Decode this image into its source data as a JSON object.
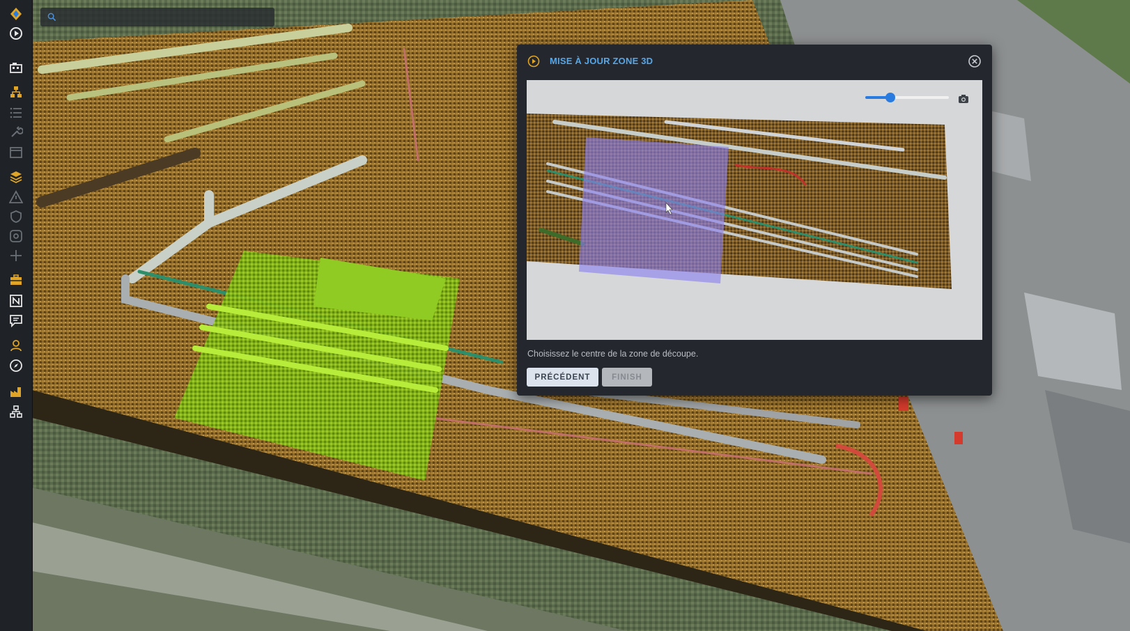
{
  "search": {
    "value": "",
    "placeholder": ""
  },
  "sidebar": {
    "items": [
      {
        "icon": "app-logo-icon"
      },
      {
        "icon": "play-circle-icon"
      },
      {
        "icon": "building-icon"
      },
      {
        "icon": "hierarchy-icon"
      },
      {
        "icon": "list-icon"
      },
      {
        "icon": "wrench-icon"
      },
      {
        "icon": "calendar-icon"
      },
      {
        "icon": "layers-icon"
      },
      {
        "icon": "warning-icon"
      },
      {
        "icon": "shield-icon"
      },
      {
        "icon": "at-sign-icon"
      },
      {
        "icon": "crosshair-icon"
      },
      {
        "icon": "toolbox-icon"
      },
      {
        "icon": "blueprint-icon"
      },
      {
        "icon": "comment-icon"
      },
      {
        "icon": "user-icon"
      },
      {
        "icon": "compass-icon"
      },
      {
        "icon": "factory-icon"
      },
      {
        "icon": "network-icon"
      }
    ]
  },
  "dialog": {
    "title": "MISE À JOUR ZONE 3D",
    "instruction": "Choisissez le centre de la zone de découpe.",
    "prev_label": "PRÉCÉDENT",
    "finish_label": "FINISH",
    "zoom_slider_value": 0.3
  },
  "colors": {
    "accent": "#56a6e8",
    "sidebar_bg": "#1f2328",
    "sidebar_icon_active": "#e0a526",
    "dialog_bg": "#24282e",
    "selection_overlay": "#8a80f0"
  }
}
